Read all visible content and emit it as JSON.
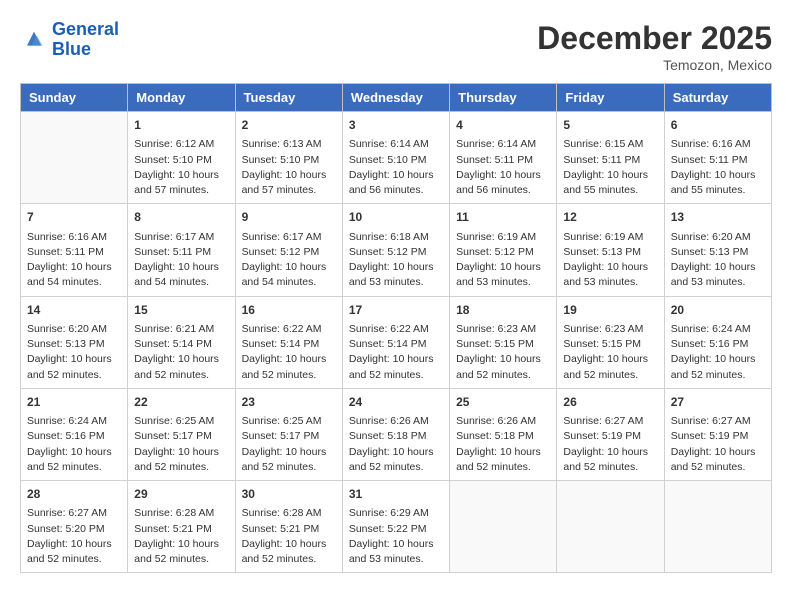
{
  "header": {
    "logo_line1": "General",
    "logo_line2": "Blue",
    "month": "December 2025",
    "location": "Temozon, Mexico"
  },
  "days_of_week": [
    "Sunday",
    "Monday",
    "Tuesday",
    "Wednesday",
    "Thursday",
    "Friday",
    "Saturday"
  ],
  "weeks": [
    [
      {
        "day": "",
        "sunrise": "",
        "sunset": "",
        "daylight": ""
      },
      {
        "day": "1",
        "sunrise": "Sunrise: 6:12 AM",
        "sunset": "Sunset: 5:10 PM",
        "daylight": "Daylight: 10 hours and 57 minutes."
      },
      {
        "day": "2",
        "sunrise": "Sunrise: 6:13 AM",
        "sunset": "Sunset: 5:10 PM",
        "daylight": "Daylight: 10 hours and 57 minutes."
      },
      {
        "day": "3",
        "sunrise": "Sunrise: 6:14 AM",
        "sunset": "Sunset: 5:10 PM",
        "daylight": "Daylight: 10 hours and 56 minutes."
      },
      {
        "day": "4",
        "sunrise": "Sunrise: 6:14 AM",
        "sunset": "Sunset: 5:11 PM",
        "daylight": "Daylight: 10 hours and 56 minutes."
      },
      {
        "day": "5",
        "sunrise": "Sunrise: 6:15 AM",
        "sunset": "Sunset: 5:11 PM",
        "daylight": "Daylight: 10 hours and 55 minutes."
      },
      {
        "day": "6",
        "sunrise": "Sunrise: 6:16 AM",
        "sunset": "Sunset: 5:11 PM",
        "daylight": "Daylight: 10 hours and 55 minutes."
      }
    ],
    [
      {
        "day": "7",
        "sunrise": "Sunrise: 6:16 AM",
        "sunset": "Sunset: 5:11 PM",
        "daylight": "Daylight: 10 hours and 54 minutes."
      },
      {
        "day": "8",
        "sunrise": "Sunrise: 6:17 AM",
        "sunset": "Sunset: 5:11 PM",
        "daylight": "Daylight: 10 hours and 54 minutes."
      },
      {
        "day": "9",
        "sunrise": "Sunrise: 6:17 AM",
        "sunset": "Sunset: 5:12 PM",
        "daylight": "Daylight: 10 hours and 54 minutes."
      },
      {
        "day": "10",
        "sunrise": "Sunrise: 6:18 AM",
        "sunset": "Sunset: 5:12 PM",
        "daylight": "Daylight: 10 hours and 53 minutes."
      },
      {
        "day": "11",
        "sunrise": "Sunrise: 6:19 AM",
        "sunset": "Sunset: 5:12 PM",
        "daylight": "Daylight: 10 hours and 53 minutes."
      },
      {
        "day": "12",
        "sunrise": "Sunrise: 6:19 AM",
        "sunset": "Sunset: 5:13 PM",
        "daylight": "Daylight: 10 hours and 53 minutes."
      },
      {
        "day": "13",
        "sunrise": "Sunrise: 6:20 AM",
        "sunset": "Sunset: 5:13 PM",
        "daylight": "Daylight: 10 hours and 53 minutes."
      }
    ],
    [
      {
        "day": "14",
        "sunrise": "Sunrise: 6:20 AM",
        "sunset": "Sunset: 5:13 PM",
        "daylight": "Daylight: 10 hours and 52 minutes."
      },
      {
        "day": "15",
        "sunrise": "Sunrise: 6:21 AM",
        "sunset": "Sunset: 5:14 PM",
        "daylight": "Daylight: 10 hours and 52 minutes."
      },
      {
        "day": "16",
        "sunrise": "Sunrise: 6:22 AM",
        "sunset": "Sunset: 5:14 PM",
        "daylight": "Daylight: 10 hours and 52 minutes."
      },
      {
        "day": "17",
        "sunrise": "Sunrise: 6:22 AM",
        "sunset": "Sunset: 5:14 PM",
        "daylight": "Daylight: 10 hours and 52 minutes."
      },
      {
        "day": "18",
        "sunrise": "Sunrise: 6:23 AM",
        "sunset": "Sunset: 5:15 PM",
        "daylight": "Daylight: 10 hours and 52 minutes."
      },
      {
        "day": "19",
        "sunrise": "Sunrise: 6:23 AM",
        "sunset": "Sunset: 5:15 PM",
        "daylight": "Daylight: 10 hours and 52 minutes."
      },
      {
        "day": "20",
        "sunrise": "Sunrise: 6:24 AM",
        "sunset": "Sunset: 5:16 PM",
        "daylight": "Daylight: 10 hours and 52 minutes."
      }
    ],
    [
      {
        "day": "21",
        "sunrise": "Sunrise: 6:24 AM",
        "sunset": "Sunset: 5:16 PM",
        "daylight": "Daylight: 10 hours and 52 minutes."
      },
      {
        "day": "22",
        "sunrise": "Sunrise: 6:25 AM",
        "sunset": "Sunset: 5:17 PM",
        "daylight": "Daylight: 10 hours and 52 minutes."
      },
      {
        "day": "23",
        "sunrise": "Sunrise: 6:25 AM",
        "sunset": "Sunset: 5:17 PM",
        "daylight": "Daylight: 10 hours and 52 minutes."
      },
      {
        "day": "24",
        "sunrise": "Sunrise: 6:26 AM",
        "sunset": "Sunset: 5:18 PM",
        "daylight": "Daylight: 10 hours and 52 minutes."
      },
      {
        "day": "25",
        "sunrise": "Sunrise: 6:26 AM",
        "sunset": "Sunset: 5:18 PM",
        "daylight": "Daylight: 10 hours and 52 minutes."
      },
      {
        "day": "26",
        "sunrise": "Sunrise: 6:27 AM",
        "sunset": "Sunset: 5:19 PM",
        "daylight": "Daylight: 10 hours and 52 minutes."
      },
      {
        "day": "27",
        "sunrise": "Sunrise: 6:27 AM",
        "sunset": "Sunset: 5:19 PM",
        "daylight": "Daylight: 10 hours and 52 minutes."
      }
    ],
    [
      {
        "day": "28",
        "sunrise": "Sunrise: 6:27 AM",
        "sunset": "Sunset: 5:20 PM",
        "daylight": "Daylight: 10 hours and 52 minutes."
      },
      {
        "day": "29",
        "sunrise": "Sunrise: 6:28 AM",
        "sunset": "Sunset: 5:21 PM",
        "daylight": "Daylight: 10 hours and 52 minutes."
      },
      {
        "day": "30",
        "sunrise": "Sunrise: 6:28 AM",
        "sunset": "Sunset: 5:21 PM",
        "daylight": "Daylight: 10 hours and 52 minutes."
      },
      {
        "day": "31",
        "sunrise": "Sunrise: 6:29 AM",
        "sunset": "Sunset: 5:22 PM",
        "daylight": "Daylight: 10 hours and 53 minutes."
      },
      {
        "day": "",
        "sunrise": "",
        "sunset": "",
        "daylight": ""
      },
      {
        "day": "",
        "sunrise": "",
        "sunset": "",
        "daylight": ""
      },
      {
        "day": "",
        "sunrise": "",
        "sunset": "",
        "daylight": ""
      }
    ]
  ]
}
